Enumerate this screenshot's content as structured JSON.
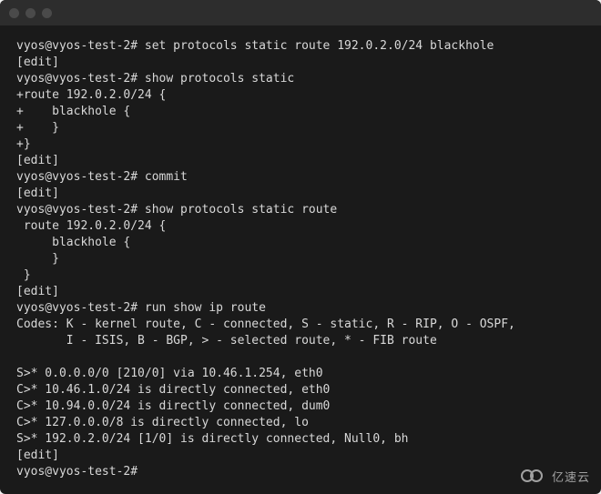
{
  "prompt": "vyos@vyos-test-2#",
  "lines": [
    {
      "type": "prompt",
      "cmd": "set protocols static route 192.0.2.0/24 blackhole"
    },
    {
      "type": "out",
      "text": "[edit]"
    },
    {
      "type": "prompt",
      "cmd": "show protocols static"
    },
    {
      "type": "out",
      "text": "+route 192.0.2.0/24 {"
    },
    {
      "type": "out",
      "text": "+    blackhole {"
    },
    {
      "type": "out",
      "text": "+    }"
    },
    {
      "type": "out",
      "text": "+}"
    },
    {
      "type": "out",
      "text": "[edit]"
    },
    {
      "type": "prompt",
      "cmd": "commit"
    },
    {
      "type": "out",
      "text": "[edit]"
    },
    {
      "type": "prompt",
      "cmd": "show protocols static route"
    },
    {
      "type": "out",
      "text": " route 192.0.2.0/24 {"
    },
    {
      "type": "out",
      "text": "     blackhole {"
    },
    {
      "type": "out",
      "text": "     }"
    },
    {
      "type": "out",
      "text": " }"
    },
    {
      "type": "out",
      "text": "[edit]"
    },
    {
      "type": "prompt",
      "cmd": "run show ip route"
    },
    {
      "type": "out",
      "text": "Codes: K - kernel route, C - connected, S - static, R - RIP, O - OSPF,"
    },
    {
      "type": "out",
      "text": "       I - ISIS, B - BGP, > - selected route, * - FIB route"
    },
    {
      "type": "out",
      "text": ""
    },
    {
      "type": "out",
      "text": "S>* 0.0.0.0/0 [210/0] via 10.46.1.254, eth0"
    },
    {
      "type": "out",
      "text": "C>* 10.46.1.0/24 is directly connected, eth0"
    },
    {
      "type": "out",
      "text": "C>* 10.94.0.0/24 is directly connected, dum0"
    },
    {
      "type": "out",
      "text": "C>* 127.0.0.0/8 is directly connected, lo"
    },
    {
      "type": "out",
      "text": "S>* 192.0.2.0/24 [1/0] is directly connected, Null0, bh"
    },
    {
      "type": "out",
      "text": "[edit]"
    },
    {
      "type": "prompt",
      "cmd": ""
    }
  ],
  "watermark": "亿速云"
}
